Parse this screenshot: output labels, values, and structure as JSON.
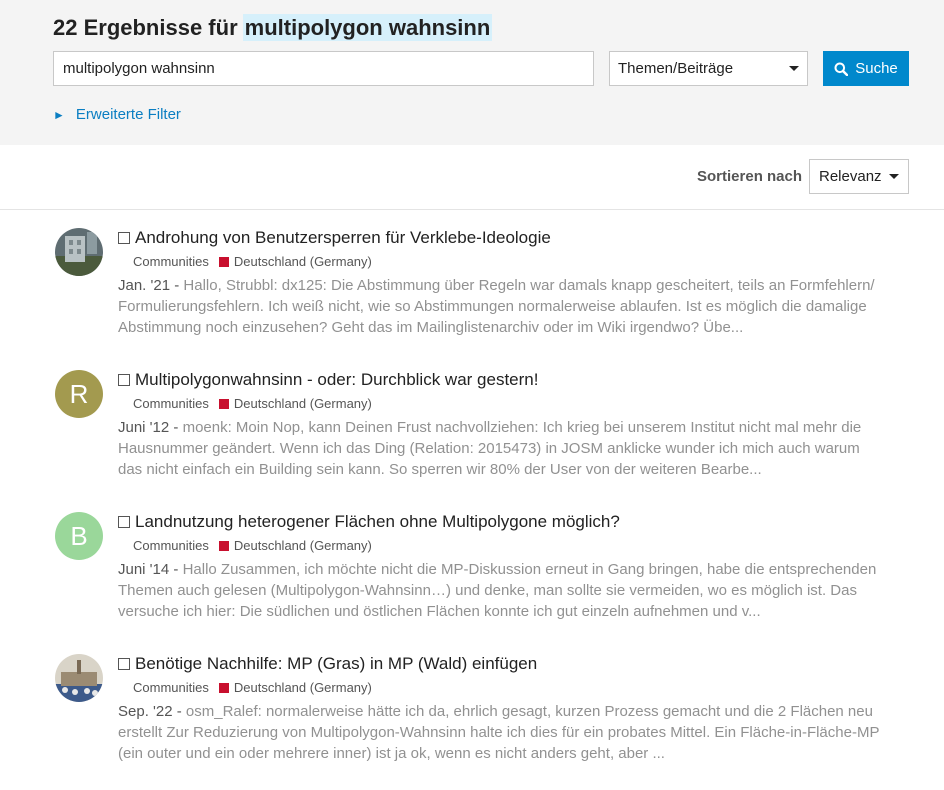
{
  "header": {
    "count_text": "22 Ergebnisse für",
    "search_term": "multipolygon wahnsinn"
  },
  "search": {
    "input_value": "multipolygon wahnsinn",
    "type_selected": "Themen/Beiträge",
    "button_label": "Suche"
  },
  "filters": {
    "advanced_label": "Erweiterte Filter"
  },
  "sort": {
    "label": "Sortieren nach",
    "selected": "Relevanz"
  },
  "results": [
    {
      "title": "Androhung von Benutzersperren für Verklebe-Ideologie",
      "category": "Communities",
      "subcategory": "Deutschland (Germany)",
      "date": "Jan. '21",
      "blurb": "Hallo, Strubbl: dx125: Die Abstimmung über Regeln war damals knapp gescheitert, teils an Formfehlern/ Formulierungsfehlern. Ich weiß nicht, wie so Abstimmungen normalerweise ablaufen. Ist es möglich die damalige Abstimmung noch einzusehen? Geht das im Mailinglistenarchiv oder im Wiki irgendwo? Übe...",
      "avatar_letter": "",
      "avatar_color": "#6a7a80"
    },
    {
      "title": "Multipolygonwahnsinn - oder: Durchblick war gestern!",
      "category": "Communities",
      "subcategory": "Deutschland (Germany)",
      "date": "Juni '12",
      "blurb": "moenk: Moin Nop, kann Deinen Frust nachvollziehen: Ich krieg bei unserem Institut nicht mal mehr die Hausnummer geändert. Wenn ich das Ding (Relation: 2015473) in JOSM anklicke wunder ich mich auch warum das nicht einfach ein Building sein kann. So sperren wir 80% der User von der weiteren Bearbe...",
      "avatar_letter": "R",
      "avatar_color": "#a39a4f"
    },
    {
      "title": "Landnutzung heterogener Flächen ohne Multipolygone möglich?",
      "category": "Communities",
      "subcategory": "Deutschland (Germany)",
      "date": "Juni '14",
      "blurb": "Hallo Zusammen, ich möchte nicht die MP-Diskussion erneut in Gang bringen, habe die entsprechenden Themen auch gelesen (Multipolygon-Wahnsinn…) und denke, man sollte sie vermeiden, wo es möglich ist. Das versuche ich hier: Die südlichen und östlichen Flächen konnte ich gut einzeln aufnehmen und v...",
      "avatar_letter": "B",
      "avatar_color": "#9ad79a"
    },
    {
      "title": "Benötige Nachhilfe: MP (Gras) in MP (Wald) einfügen",
      "category": "Communities",
      "subcategory": "Deutschland (Germany)",
      "date": "Sep. '22",
      "blurb": "osm_Ralef: normalerweise hätte ich da, ehrlich gesagt, kurzen Prozess gemacht und die 2 Flächen neu erstellt Zur Reduzierung von Multipolygon-Wahnsinn halte ich dies für ein probates Mittel. Ein Fläche-in-Fläche-MP (ein outer und ein oder mehrere inner) ist ja ok, wenn es nicht anders geht, aber ...",
      "avatar_letter": "",
      "avatar_color": "#8a8f96"
    }
  ],
  "colors": {
    "accent": "#0088cc",
    "link": "#0a7ec2",
    "category_square": "#c8102e",
    "highlight": "#d6f0fb"
  }
}
